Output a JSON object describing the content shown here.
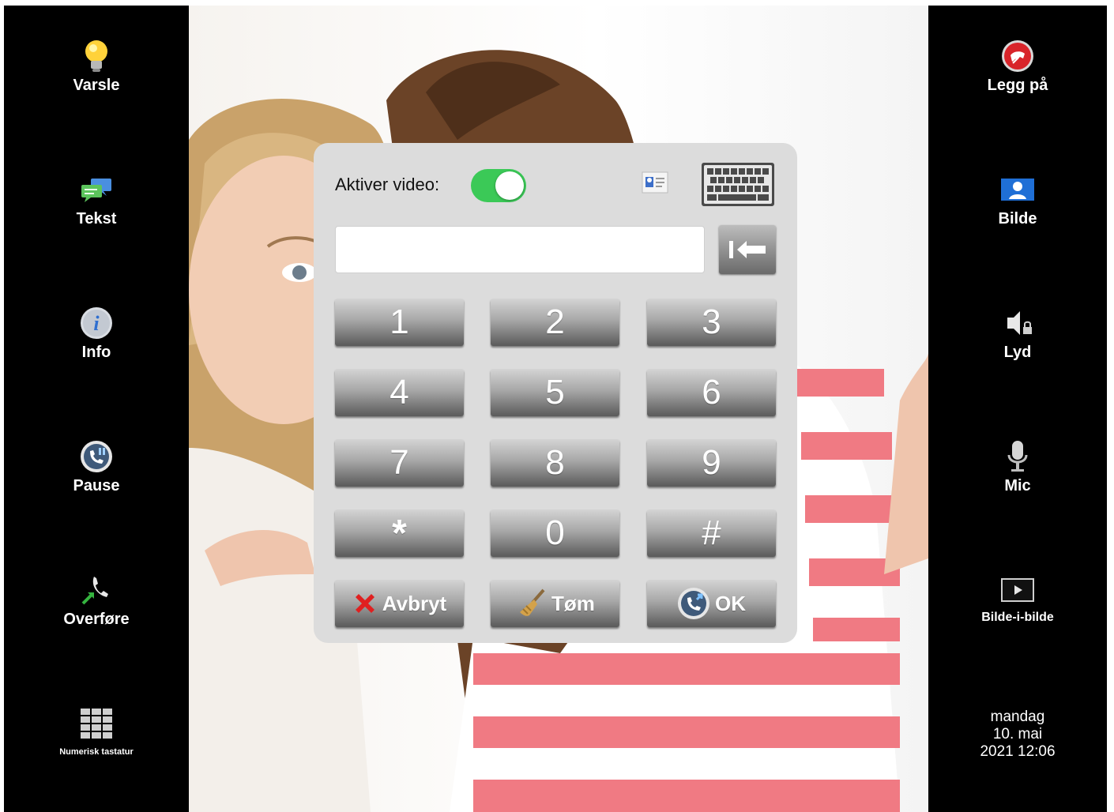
{
  "left_sidebar": {
    "items": [
      {
        "label": "Varsle",
        "icon": "lightbulb-icon"
      },
      {
        "label": "Tekst",
        "icon": "chat-bubbles-icon"
      },
      {
        "label": "Info",
        "icon": "info-icon"
      },
      {
        "label": "Pause",
        "icon": "phone-pause-icon"
      },
      {
        "label": "Overføre",
        "icon": "phone-transfer-icon"
      },
      {
        "label": "Numerisk tastatur",
        "icon": "keypad-grid-icon"
      }
    ]
  },
  "right_sidebar": {
    "items": [
      {
        "label": "Legg på",
        "icon": "hang-up-icon"
      },
      {
        "label": "Bilde",
        "icon": "contact-picture-icon"
      },
      {
        "label": "Lyd",
        "icon": "speaker-lock-icon"
      },
      {
        "label": "Mic",
        "icon": "microphone-icon"
      },
      {
        "label": "Bilde-i-bilde",
        "icon": "picture-in-picture-icon"
      }
    ],
    "datetime": {
      "day": "mandag",
      "date": "10. mai",
      "time": "2021 12:06"
    }
  },
  "dialer": {
    "video_label": "Aktiver video:",
    "video_enabled": true,
    "number_value": "",
    "keys": [
      "1",
      "2",
      "3",
      "4",
      "5",
      "6",
      "7",
      "8",
      "9",
      "*",
      "0",
      "#"
    ],
    "cancel_label": "Avbryt",
    "clear_label": "Tøm",
    "ok_label": "OK"
  },
  "colors": {
    "toggle_on": "#3bc957",
    "sidebar_bg": "#000000",
    "panel_bg": "#dcdcdc",
    "cancel_x": "#e02020"
  }
}
